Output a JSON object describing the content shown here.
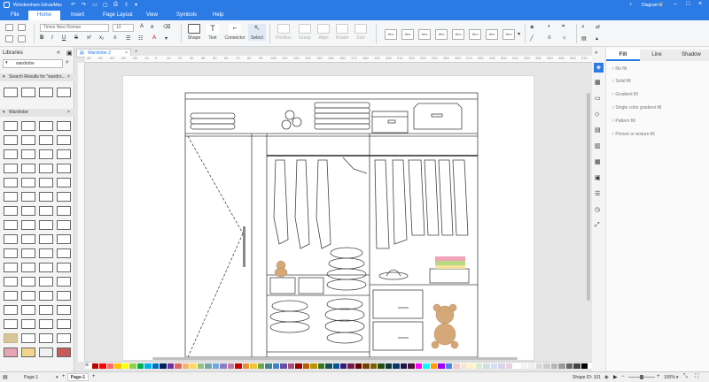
{
  "app": {
    "title": "Wondershare EdrawMax"
  },
  "titlebar": {
    "diagram_label": "Diagram"
  },
  "menu": {
    "items": [
      "File",
      "Home",
      "Insert",
      "Page Layout",
      "View",
      "Symbols",
      "Help"
    ],
    "active": "Home"
  },
  "ribbon": {
    "font_name": "Times New Roman",
    "font_size": "12",
    "tools": [
      "Shape",
      "Text",
      "Connector",
      "Select"
    ],
    "arrange": [
      "Position",
      "Group",
      "Align",
      "Rotate",
      "Size"
    ],
    "style_label": "Abc"
  },
  "libraries": {
    "title": "Libraries",
    "search_value": "wardrobe",
    "search_results_label": "Search Results for \"wardro...",
    "section_label": "Wardrobe"
  },
  "document": {
    "tab_label": "Wardrobe 2"
  },
  "ruler_ticks": [
    "-60",
    "-50",
    "-40",
    "-30",
    "-20",
    "-10",
    "0",
    "10",
    "20",
    "30",
    "40",
    "50",
    "60",
    "70",
    "80",
    "90",
    "100",
    "110",
    "120",
    "130",
    "140",
    "150",
    "160",
    "170",
    "180",
    "190",
    "200",
    "210",
    "220",
    "230",
    "240",
    "250",
    "260",
    "270",
    "280",
    "290",
    "300",
    "310",
    "320",
    "330",
    "340",
    "350",
    "360",
    "370"
  ],
  "fill_panel": {
    "tabs": [
      "Fill",
      "Line",
      "Shadow"
    ],
    "active_tab": "Fill",
    "options": [
      "No fill",
      "Solid fill",
      "Gradient fill",
      "Single color gradient fill",
      "Pattern fill",
      "Picture or texture fill"
    ]
  },
  "status": {
    "page_select": "Page-1",
    "page_tab": "Page-1",
    "shape_id": "Shape ID: 101",
    "zoom": "100%"
  },
  "palette_colors": [
    "#c00000",
    "#ff0000",
    "#ff6a6a",
    "#ffc000",
    "#ffff00",
    "#92d050",
    "#00b050",
    "#00b0f0",
    "#0070c0",
    "#002060",
    "#7030a0",
    "#e06666",
    "#f6b26b",
    "#ffd966",
    "#93c47d",
    "#76a5af",
    "#6fa8dc",
    "#8e7cc3",
    "#c27ba0",
    "#cc0000",
    "#e69138",
    "#f1c232",
    "#6aa84f",
    "#45818e",
    "#3d85c6",
    "#674ea7",
    "#a64d79",
    "#990000",
    "#b45f06",
    "#bf9000",
    "#38761d",
    "#134f5c",
    "#0b5394",
    "#351c75",
    "#741b47",
    "#660000",
    "#783f04",
    "#7f6000",
    "#274e13",
    "#0c343d",
    "#073763",
    "#20124d",
    "#4c1130",
    "#ff00ff",
    "#00ffff",
    "#ff9900",
    "#9900ff",
    "#4a86e8",
    "#f4cccc",
    "#fce5cd",
    "#fff2cc",
    "#d9ead3",
    "#d0e0e3",
    "#cfe2f3",
    "#d9d2e9",
    "#ead1dc",
    "#ffffff",
    "#f3f3f3",
    "#efefef",
    "#d9d9d9",
    "#cccccc",
    "#b7b7b7",
    "#999999",
    "#666666",
    "#434343",
    "#000000"
  ]
}
